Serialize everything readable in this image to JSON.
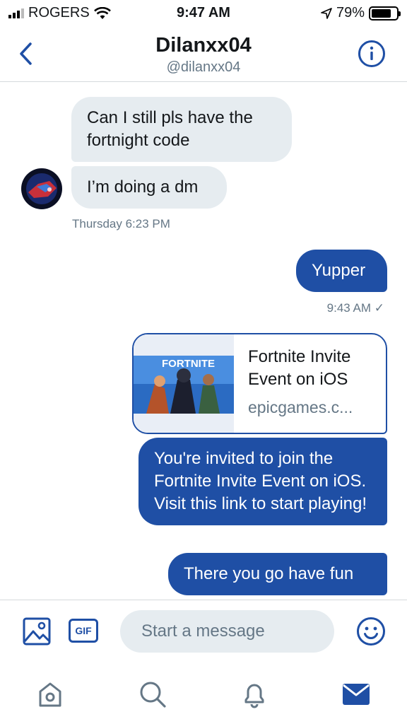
{
  "status_bar": {
    "carrier": "ROGERS",
    "time": "9:47 AM",
    "battery": "79%",
    "battery_level": 0.79
  },
  "header": {
    "display_name": "Dilanxx04",
    "handle": "@dilanxx04",
    "back_icon": "chevron-left-icon",
    "info_icon": "info-icon"
  },
  "messages": {
    "incoming": [
      {
        "text": "Can I still pls have the fortnight code"
      },
      {
        "text": "I’m doing a dm"
      }
    ],
    "incoming_time": "Thursday 6:23 PM",
    "outgoing_first": {
      "text": "Yupper"
    },
    "outgoing_time": "9:43 AM ✓",
    "link_card": {
      "thumb_brand": "FORTNITE",
      "title": "Fortnite Invite Event on iOS",
      "domain": "epicgames.c..."
    },
    "outgoing_invite": {
      "text": "You're invited to join the Fortnite Invite Event on iOS. Visit this link to start playing!"
    },
    "outgoing_last": {
      "text": "There you go have fun"
    }
  },
  "composer": {
    "gif_label": "GIF",
    "placeholder": "Start a message"
  },
  "tabbar": {
    "items": [
      "home-icon",
      "search-icon",
      "notifications-icon",
      "messages-icon"
    ]
  },
  "colors": {
    "accent": "#1f4fa5",
    "incoming_bubble": "#e6ecf0",
    "secondary_text": "#657786"
  }
}
